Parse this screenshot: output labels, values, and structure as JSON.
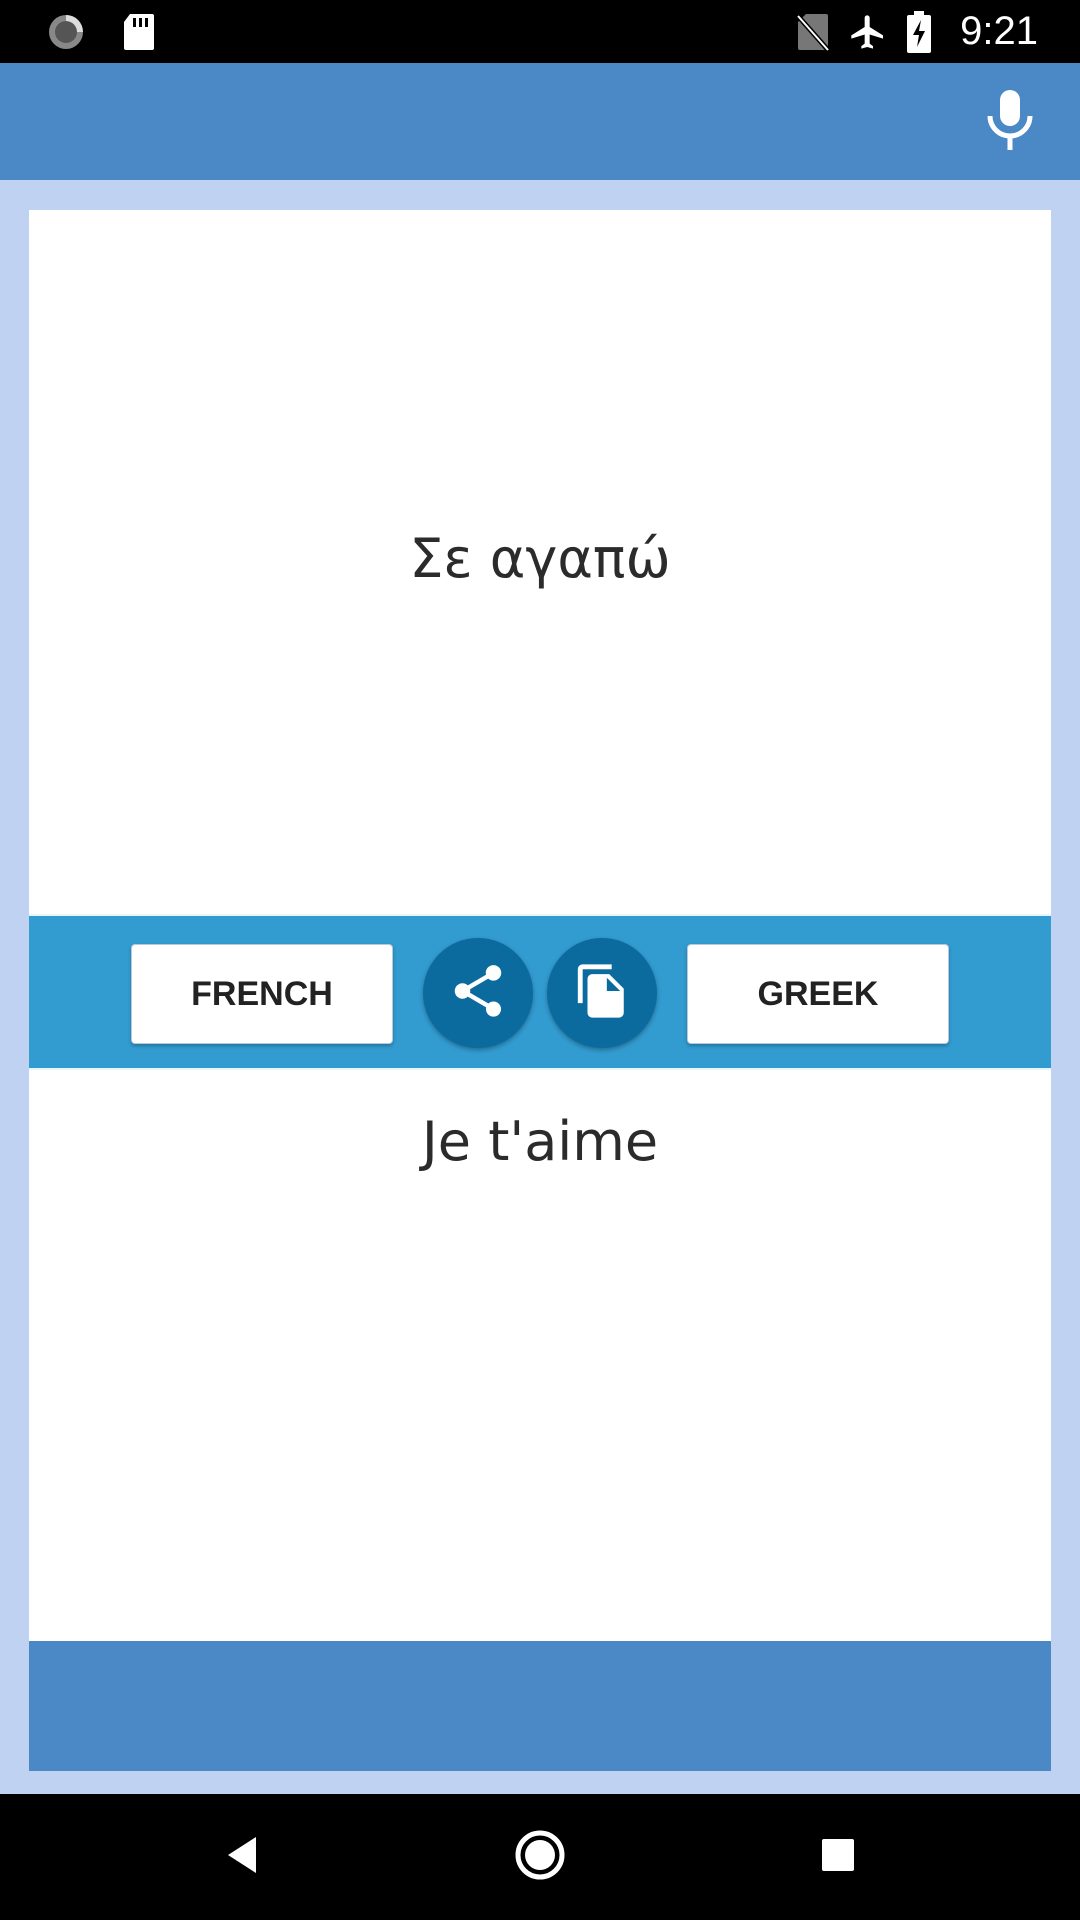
{
  "status_bar": {
    "time": "9:21",
    "icons": [
      "sync-icon",
      "sd-card-icon",
      "no-sim-icon",
      "airplane-mode-icon",
      "battery-charging-icon"
    ]
  },
  "app_bar": {
    "mic_icon": "microphone-icon"
  },
  "translator": {
    "source_text": "Σε αγαπώ",
    "target_text": "Je t'aime",
    "left_language": "FRENCH",
    "right_language": "GREEK",
    "share_icon": "share-icon",
    "copy_icon": "copy-icon"
  },
  "nav_bar": {
    "icons": [
      "back-icon",
      "home-icon",
      "recent-apps-icon"
    ]
  },
  "colors": {
    "app_bar": "#4a88c6",
    "background": "#c0d2f1",
    "controls_bar": "#329bd0",
    "round_button": "#0c6b9e"
  }
}
